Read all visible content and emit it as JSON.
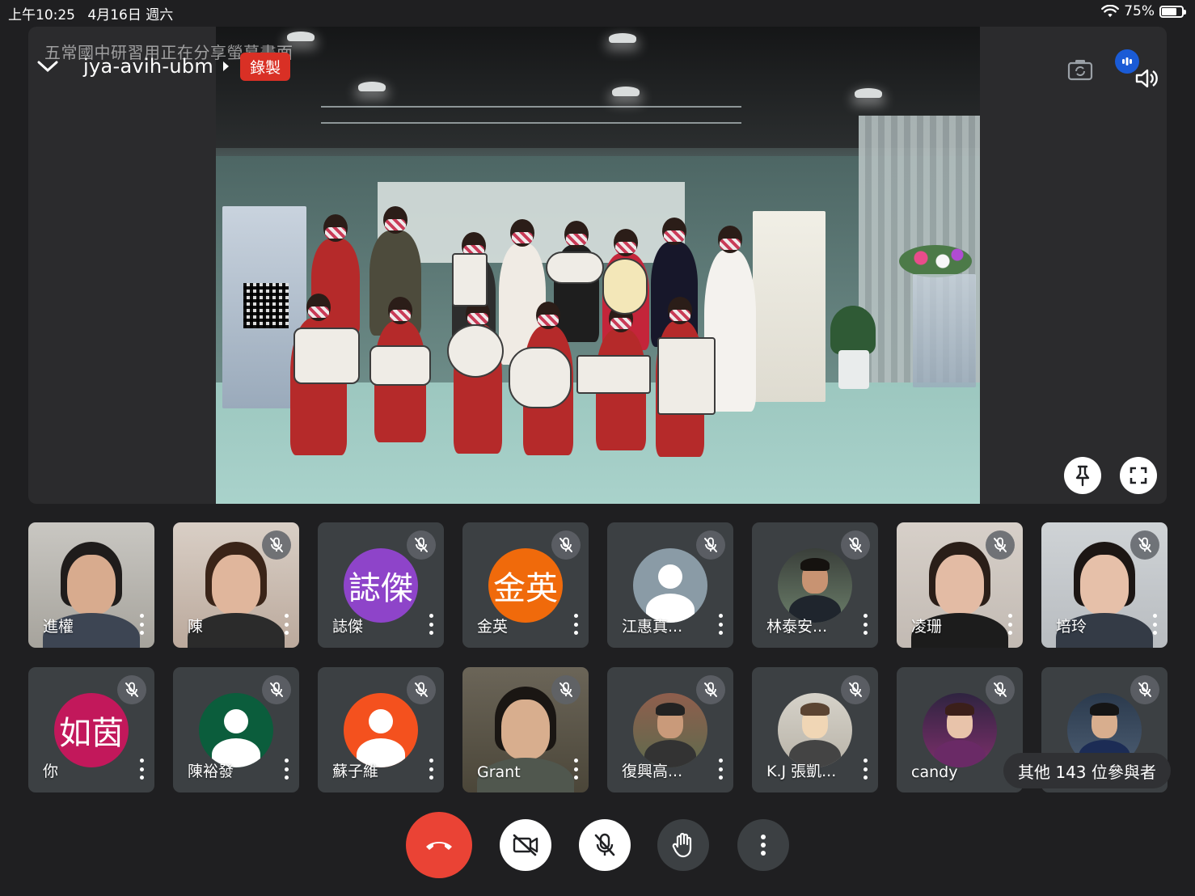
{
  "status_bar": {
    "time": "上午10:25",
    "date": "4月16日 週六",
    "battery": "75%",
    "battery_level": 0.75,
    "wifi_icon": "wifi-icon"
  },
  "meeting": {
    "presenter_notice": "五常國中研習用正在分享螢幕畫面",
    "code": "jya-avih-ubm",
    "recording_label": "錄製"
  },
  "participants": [
    {
      "name": "進權",
      "type": "video",
      "muted": false
    },
    {
      "name": "陳",
      "type": "video",
      "muted": true
    },
    {
      "name": "誌傑",
      "type": "avatar",
      "initials": "誌傑",
      "color": "#8e44c9",
      "muted": true
    },
    {
      "name": "金英",
      "type": "avatar",
      "initials": "金英",
      "color": "#f06a0b",
      "muted": true
    },
    {
      "name": "江惠真...",
      "type": "silhouette",
      "color": "#8a9ba6",
      "muted": true
    },
    {
      "name": "林泰安...",
      "type": "photo",
      "muted": true
    },
    {
      "name": "凌珊",
      "type": "video",
      "muted": true
    },
    {
      "name": "培玲",
      "type": "video",
      "muted": true
    },
    {
      "name": "你",
      "type": "avatar",
      "initials": "如茵",
      "color": "#c2185b",
      "muted": true
    },
    {
      "name": "陳裕發",
      "type": "silhouette",
      "color": "#0b5d3c",
      "muted": true
    },
    {
      "name": "蘇子維",
      "type": "silhouette",
      "color": "#f4511e",
      "muted": true
    },
    {
      "name": "Grant",
      "type": "video",
      "muted": true
    },
    {
      "name": "復興高...",
      "type": "photo",
      "muted": true
    },
    {
      "name": "K.J 張凱...",
      "type": "photo",
      "muted": true
    },
    {
      "name": "candy",
      "type": "photo",
      "muted": true
    },
    {
      "name": "",
      "type": "photo",
      "muted": true
    }
  ],
  "others_count": "其他 143 位參與者",
  "controls": {
    "end_call": "phone-hangup-icon",
    "camera": "camera-off-icon",
    "mic": "mic-off-icon",
    "hand": "raise-hand-icon",
    "more": "more-vert-icon"
  },
  "colors": {
    "background": "#1f1f21",
    "tile": "#3c4043",
    "recording": "#d93025",
    "end_call": "#ea4335",
    "speaking": "#1a5bd6"
  }
}
